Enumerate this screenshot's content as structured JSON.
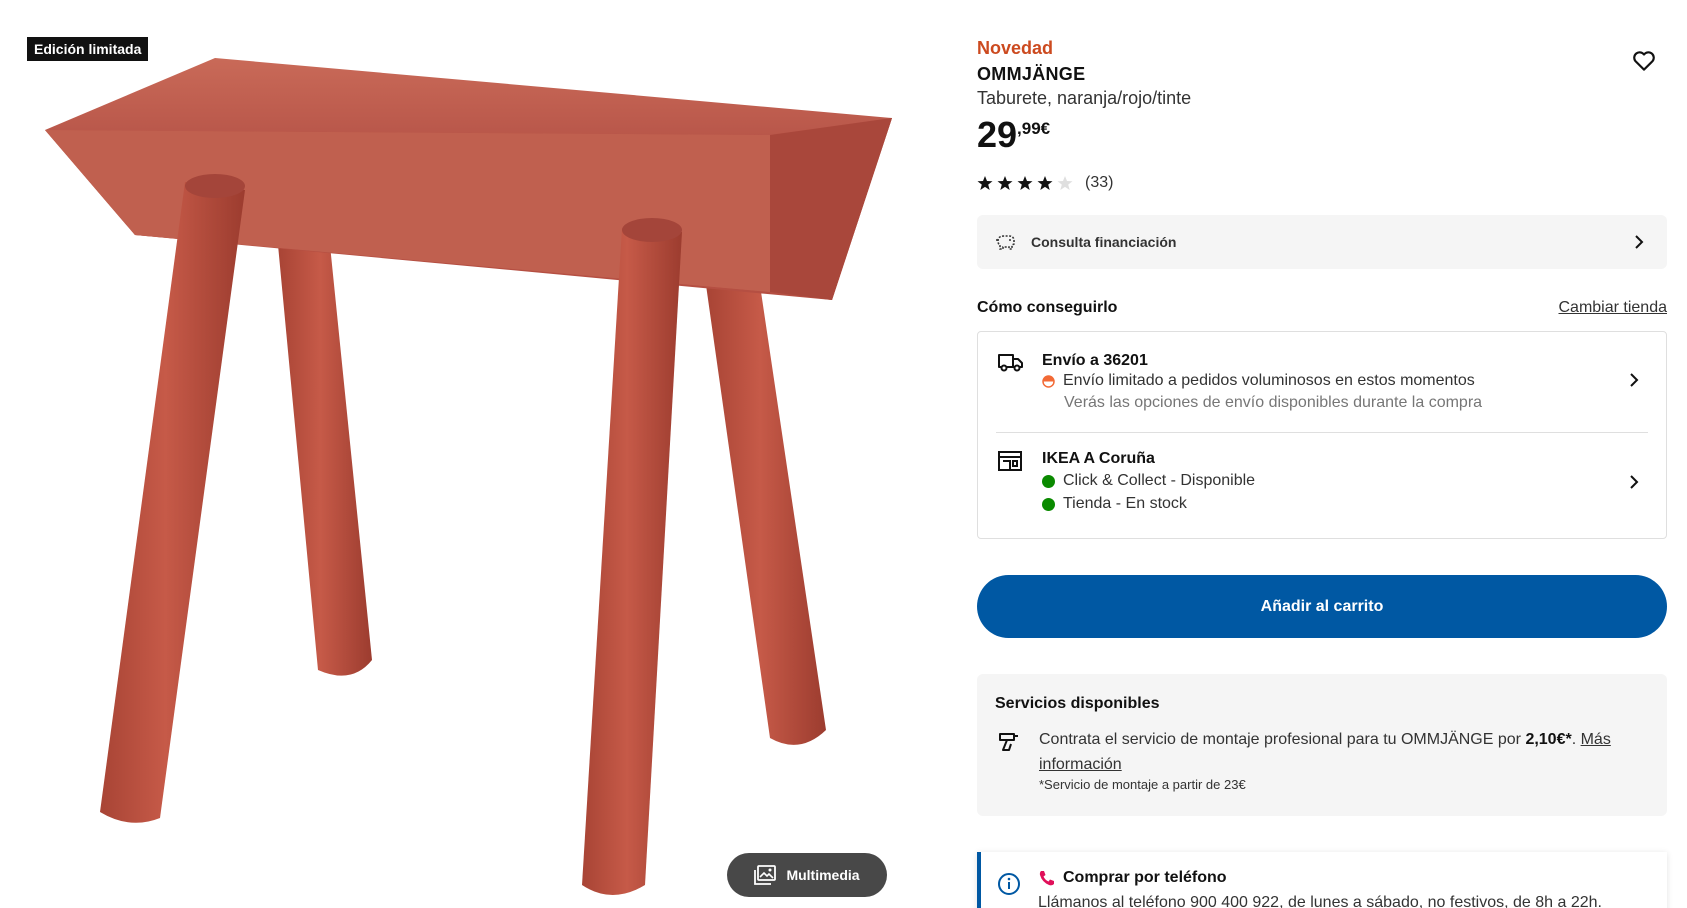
{
  "media": {
    "badge": "Edición limitada",
    "multimedia_label": "Multimedia",
    "product_color": "#c25a4a"
  },
  "product": {
    "tag": "Novedad",
    "name": "OMMJÄNGE",
    "description": "Taburete, naranja/rojo/tinte",
    "price_int": "29",
    "price_dec": ",99€",
    "rating_value": 4,
    "rating_max": 5,
    "rating_count": "(33)"
  },
  "finance": {
    "label": "Consulta financiación"
  },
  "availability": {
    "title": "Cómo conseguirlo",
    "change_store": "Cambiar tienda",
    "delivery": {
      "title": "Envío a 36201",
      "status": "Envío limitado a pedidos voluminosos en estos momentos",
      "note": "Verás las opciones de envío disponibles durante la compra"
    },
    "store": {
      "title": "IKEA A Coruña",
      "collect": "Click & Collect - Disponible",
      "stock": "Tienda - En stock"
    }
  },
  "cart": {
    "label": "Añadir al carrito"
  },
  "services": {
    "title": "Servicios disponibles",
    "text_pre": "Contrata el servicio de montaje profesional para tu OMMJÄNGE por ",
    "price": "2,10€*",
    "text_post": ". ",
    "link": "Más información",
    "note": "*Servicio de montaje a partir de 23€"
  },
  "phone": {
    "title": "Comprar por teléfono",
    "text": "Llámanos al teléfono 900 400 922, de lunes a sábado, no festivos, de 8h a 22h."
  },
  "colors": {
    "accent_orange": "#cc4a1f",
    "primary_blue": "#0058a3",
    "stock_green": "#0a8a00"
  }
}
